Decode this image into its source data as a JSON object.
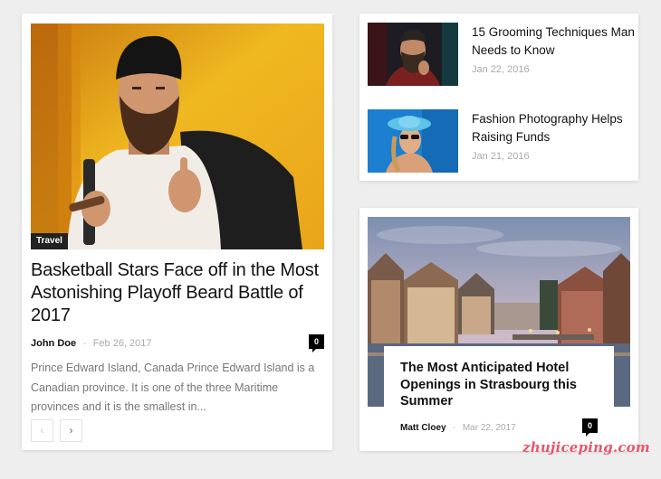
{
  "main_post": {
    "category": "Travel",
    "title": "Basketball Stars Face off in the Most Astonishing Playoff Beard Battle of 2017",
    "author": "John Doe",
    "separator": "-",
    "date": "Feb 26, 2017",
    "comments": "0",
    "excerpt": "Prince Edward Island, Canada Prince Edward Island is a Canadian province. It is one of the three Maritime provinces and it is the smallest in...",
    "prev_icon": "‹",
    "next_icon": "›"
  },
  "list_posts": [
    {
      "title": "15 Grooming Techniques Man Needs to Know",
      "date": "Jan 22, 2016"
    },
    {
      "title": "Fashion Photography Helps Raising Funds",
      "date": "Jan 21, 2016"
    }
  ],
  "feature_post": {
    "title": "The Most Anticipated Hotel Openings in Strasbourg this Summer",
    "author": "Matt Cloey",
    "separator": "-",
    "date": "Mar 22, 2017",
    "comments": "0"
  },
  "watermark": "zhujiceping.com",
  "colors": {
    "background": "#eeeeee",
    "badge": "#000000",
    "watermark": "#e8556a"
  }
}
